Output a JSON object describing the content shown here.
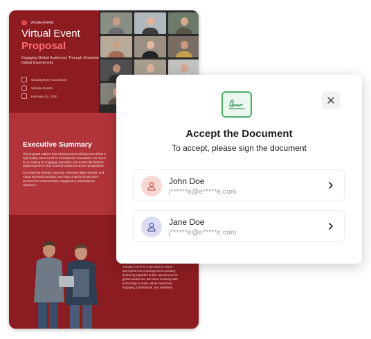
{
  "document": {
    "brand": "Virtuala Events",
    "title_line1": "Virtual Event",
    "title_line2": "Proposal",
    "subtitle": "Engaging Global Audiences Through Seamless Digital Experiences",
    "meta": [
      "CloudSphere Innovations",
      "Virtuala Events",
      "February 15, 2030"
    ],
    "section_title": "Executive Summary",
    "section_text_1": "This proposal outlines how Virtuala Events will plan and deliver a high-quality virtual event for CloudSphere Innovations. Our focus is on creating an engaging, interactive, and technically flawless digital experience that connects audiences across geographies.",
    "section_text_2": "By combining strategic planning, immersive digital formats, and robust technical execution, we ensure that the virtual event achieves its communication, engagement, and business objectives.",
    "about_text": "Virtuala Events is a specialized virtual and hybrid event management company delivering impactful online experiences for global audiences. We blend creativity with technology to make virtual events feel engaging, professional, and seamless."
  },
  "modal": {
    "icon": "signature-icon",
    "title": "Accept the Document",
    "subtitle": "To accept, please sign the document",
    "signers": [
      {
        "name": "John Doe",
        "email": "j******e@e*****e.com",
        "avatar_color": "#f7d8d2",
        "icon_color": "#c9574a"
      },
      {
        "name": "Jane Doe",
        "email": "j******e@e*****e.com",
        "avatar_color": "#dcdcf3",
        "icon_color": "#5a5aa6"
      }
    ]
  },
  "colors": {
    "accent_green": "#4caf6c",
    "doc_red": "#8d1c21",
    "doc_red_light": "#b0343a",
    "title_pink": "#ff6d73"
  }
}
